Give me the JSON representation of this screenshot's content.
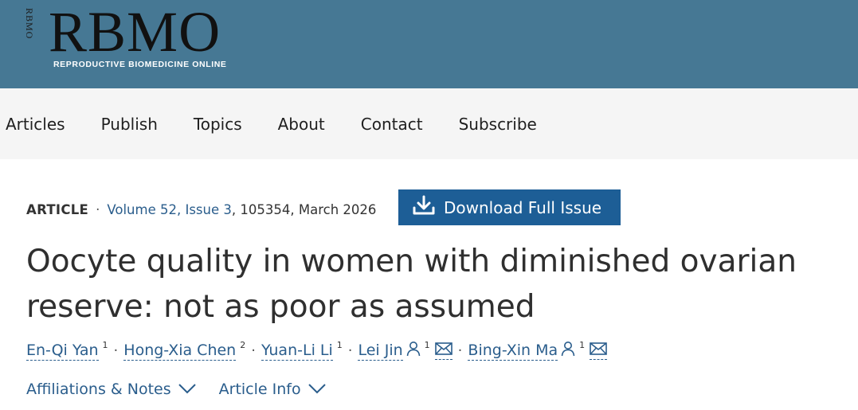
{
  "header": {
    "logo_vertical": "RBMO",
    "logo_main": "RBMO",
    "logo_subtitle": "REPRODUCTIVE BIOMEDICINE ONLINE",
    "bg_color": "#467894"
  },
  "nav": {
    "items": [
      {
        "label": "Articles"
      },
      {
        "label": "Publish"
      },
      {
        "label": "Topics"
      },
      {
        "label": "About"
      },
      {
        "label": "Contact"
      },
      {
        "label": "Subscribe"
      }
    ]
  },
  "meta": {
    "article_type": "ARTICLE",
    "separator": "·",
    "volume_link": "Volume 52, Issue 3",
    "rest": ", 105354, March 2026"
  },
  "download_button": {
    "label": "Download Full Issue",
    "icon": "download-icon",
    "color": "#1d5e96"
  },
  "article": {
    "title": "Oocyte quality in women with diminished ovarian reserve: not as poor as assumed"
  },
  "authors": [
    {
      "name": "En-Qi Yan",
      "sup": "1",
      "corresponding": false
    },
    {
      "name": "Hong-Xia Chen",
      "sup": "2",
      "corresponding": false
    },
    {
      "name": "Yuan-Li Li",
      "sup": "1",
      "corresponding": false
    },
    {
      "name": "Lei Jin",
      "sup": "1",
      "corresponding": true
    },
    {
      "name": "Bing-Xin Ma",
      "sup": "1",
      "corresponding": true
    }
  ],
  "author_separator": "·",
  "links": {
    "affiliations": "Affiliations & Notes",
    "article_info": "Article Info"
  },
  "link_color": "#2a5d8c"
}
